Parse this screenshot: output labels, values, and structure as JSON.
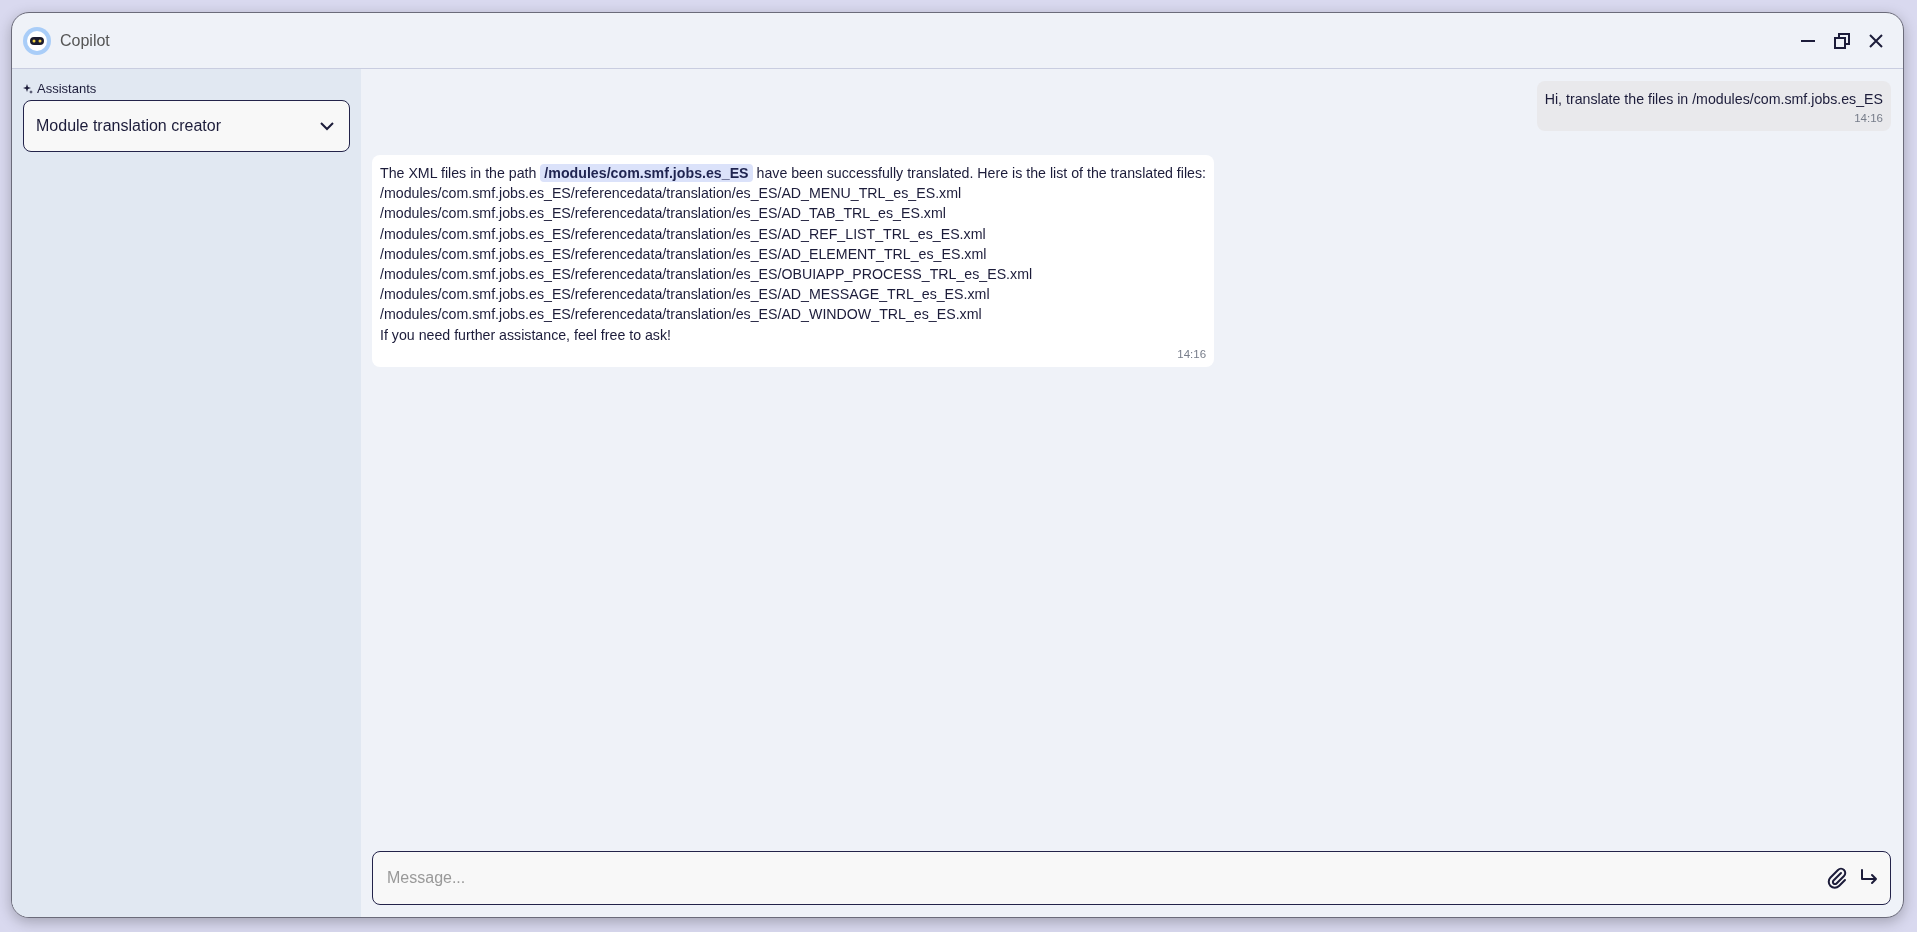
{
  "window": {
    "title": "Copilot"
  },
  "sidebar": {
    "label": "Assistants",
    "assistant_select": {
      "value": "Module translation creator"
    }
  },
  "messages": [
    {
      "kind": "user",
      "lines": [
        "Hi, translate the files in /modules/com.smf.jobs.es_ES"
      ],
      "time": "14:16"
    },
    {
      "kind": "assistant",
      "lines": [
        "The XML files in the path **/modules/com.smf.jobs.es_ES** have been successfully translated. Here is the list of the translated files:",
        "/modules/com.smf.jobs.es_ES/referencedata/translation/es_ES/AD_MENU_TRL_es_ES.xml",
        "/modules/com.smf.jobs.es_ES/referencedata/translation/es_ES/AD_TAB_TRL_es_ES.xml",
        "/modules/com.smf.jobs.es_ES/referencedata/translation/es_ES/AD_REF_LIST_TRL_es_ES.xml",
        "/modules/com.smf.jobs.es_ES/referencedata/translation/es_ES/AD_ELEMENT_TRL_es_ES.xml",
        "/modules/com.smf.jobs.es_ES/referencedata/translation/es_ES/OBUIAPP_PROCESS_TRL_es_ES.xml",
        "/modules/com.smf.jobs.es_ES/referencedata/translation/es_ES/AD_MESSAGE_TRL_es_ES.xml",
        "/modules/com.smf.jobs.es_ES/referencedata/translation/es_ES/AD_WINDOW_TRL_es_ES.xml",
        "If you need further assistance, feel free to ask!"
      ],
      "time": "14:16"
    }
  ],
  "composer": {
    "placeholder": "Message..."
  }
}
